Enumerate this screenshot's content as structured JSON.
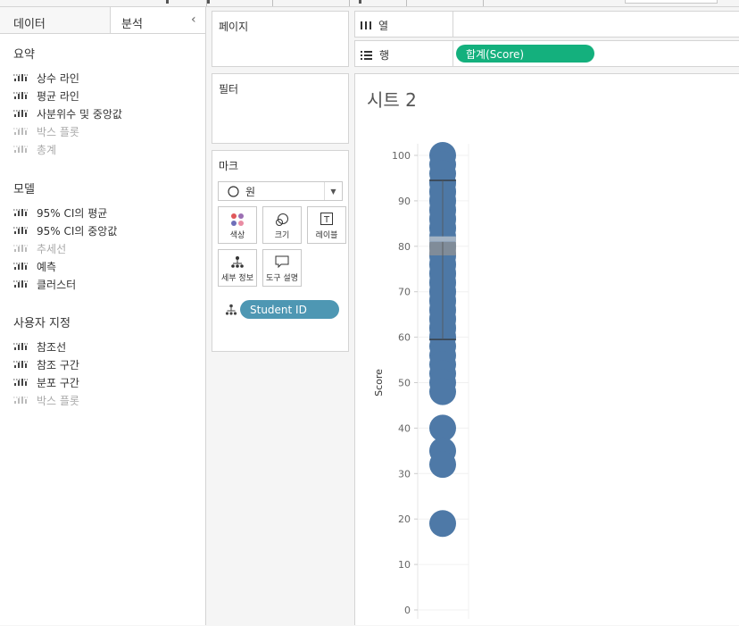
{
  "left_pane": {
    "tabs": [
      {
        "label": "데이터"
      },
      {
        "label": "분석"
      }
    ],
    "sections": [
      {
        "title": "요약",
        "items": [
          {
            "label": "상수 라인",
            "enabled": true
          },
          {
            "label": "평균 라인",
            "enabled": true
          },
          {
            "label": "사분위수 및 중앙값",
            "enabled": true
          },
          {
            "label": "박스 플롯",
            "enabled": false
          },
          {
            "label": "총계",
            "enabled": false
          }
        ]
      },
      {
        "title": "모델",
        "items": [
          {
            "label": "95% CI의 평균",
            "enabled": true
          },
          {
            "label": "95% CI의 중앙값",
            "enabled": true
          },
          {
            "label": "추세선",
            "enabled": false
          },
          {
            "label": "예측",
            "enabled": true
          },
          {
            "label": "클러스터",
            "enabled": true
          }
        ]
      },
      {
        "title": "사용자 지정",
        "items": [
          {
            "label": "참조선",
            "enabled": true
          },
          {
            "label": "참조 구간",
            "enabled": true
          },
          {
            "label": "분포 구간",
            "enabled": true
          },
          {
            "label": "박스 플롯",
            "enabled": false
          }
        ]
      }
    ]
  },
  "shelves": {
    "pages_title": "페이지",
    "filters_title": "필터",
    "marks_title": "마크",
    "mark_type": "원",
    "mark_buttons": [
      {
        "label": "색상",
        "icon": "color-dots-icon"
      },
      {
        "label": "크기",
        "icon": "size-circles-icon"
      },
      {
        "label": "레이블",
        "icon": "label-t-icon"
      },
      {
        "label": "세부 정보",
        "icon": "detail-hierarchy-icon"
      },
      {
        "label": "도구 설명",
        "icon": "tooltip-bubble-icon"
      }
    ],
    "detail_pill": "Student ID",
    "columns_label": "열",
    "rows_label": "행",
    "rows_pill": "합계(Score)"
  },
  "colors": {
    "pill_green": "#14b07d",
    "pill_blue": "#4e97b3",
    "mark_blue": "#4e79a7",
    "box_gray": "#8a8f96"
  },
  "sheet": {
    "title": "시트 2"
  },
  "chart_data": {
    "type": "scatter",
    "ylabel": "Score",
    "ylim": [
      0,
      105
    ],
    "yticks": [
      0,
      10,
      20,
      30,
      40,
      50,
      60,
      70,
      80,
      90,
      100
    ],
    "values": [
      100,
      98,
      96,
      94,
      92,
      90,
      88,
      86,
      84,
      82,
      80,
      78,
      76,
      74,
      72,
      70,
      68,
      66,
      64,
      62,
      60,
      58,
      56,
      54,
      52,
      50,
      48,
      40,
      35,
      32,
      19
    ],
    "boxplot": {
      "q1": 59.5,
      "median": 78,
      "q3": 94.5,
      "lower_band_top": 81
    }
  }
}
